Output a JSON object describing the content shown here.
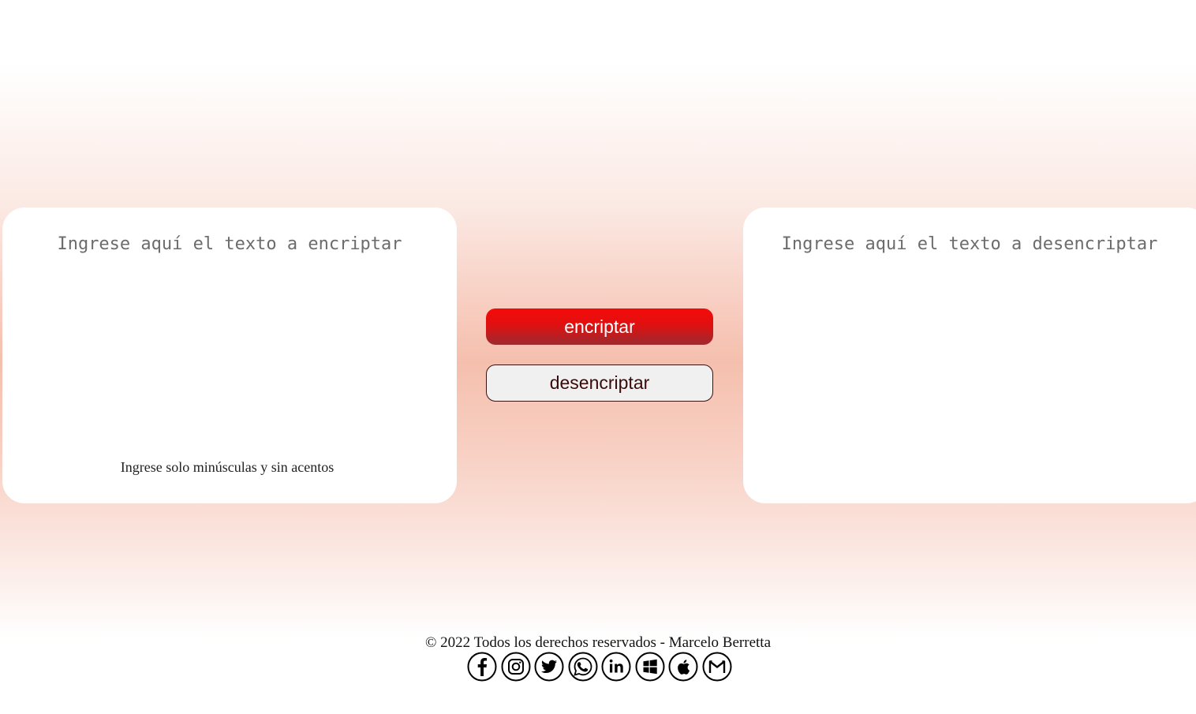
{
  "encrypt_panel": {
    "placeholder": "Ingrese aquí el texto a encriptar",
    "hint": "Ingrese solo minúsculas y sin acentos"
  },
  "decrypt_panel": {
    "placeholder": "Ingrese aquí el texto a desencriptar"
  },
  "buttons": {
    "encrypt_label": "encriptar",
    "decrypt_label": "desencriptar"
  },
  "footer": {
    "copyright": "© 2022 Todos los derechos reservados - Marcelo Berretta",
    "social_icons": [
      "facebook-icon",
      "instagram-icon",
      "twitter-icon",
      "whatsapp-icon",
      "linkedin-icon",
      "windows-icon",
      "apple-icon",
      "gmail-icon"
    ]
  },
  "colors": {
    "accent_red": "#e01010",
    "background_peach": "#f5bfad"
  }
}
